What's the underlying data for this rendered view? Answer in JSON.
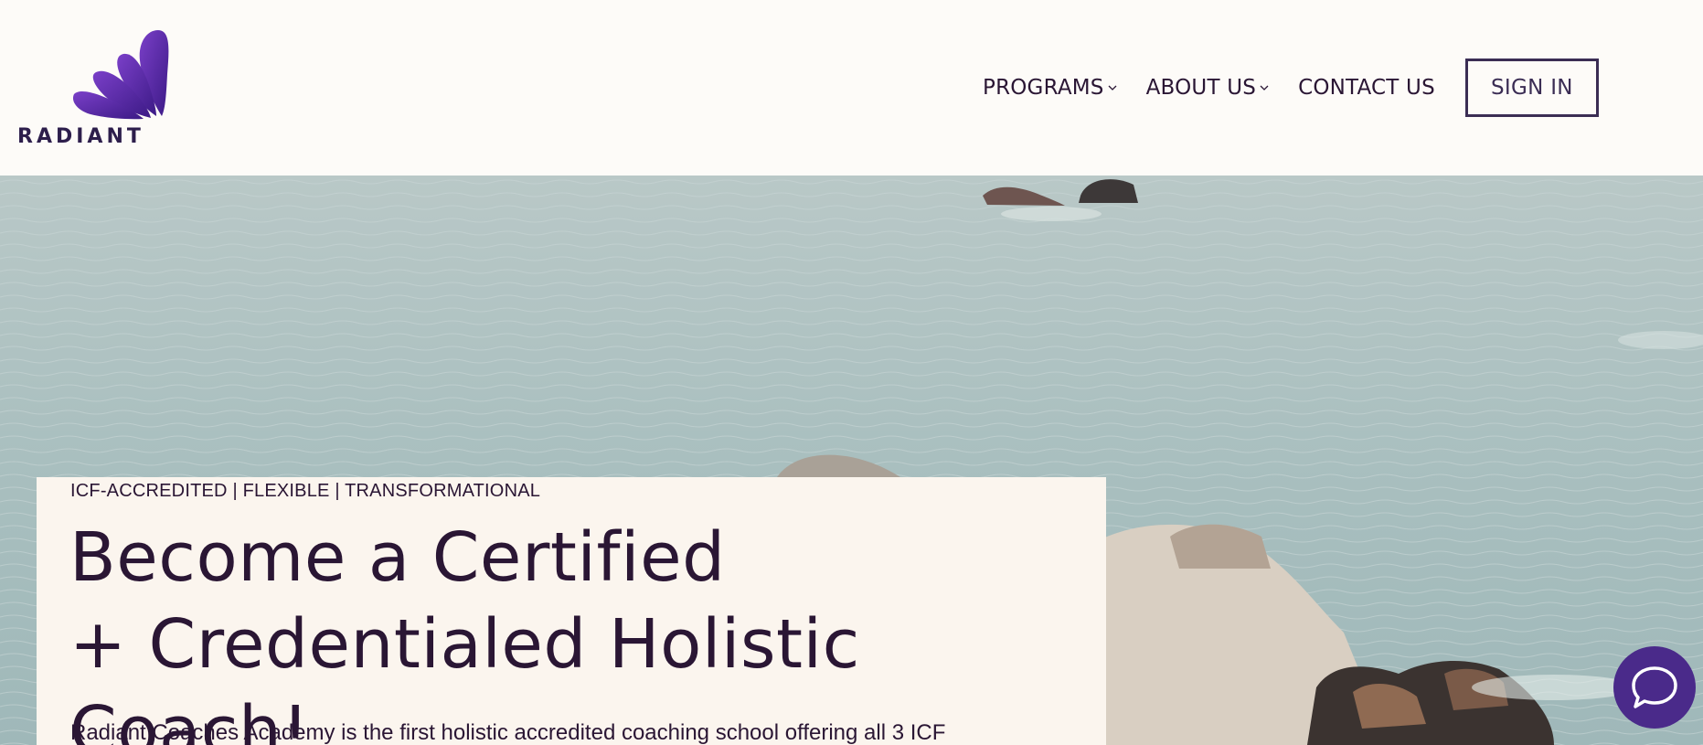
{
  "brand": {
    "name": "RADIANT"
  },
  "nav": {
    "items": [
      {
        "label": "PROGRAMS",
        "has_dropdown": true
      },
      {
        "label": "ABOUT US",
        "has_dropdown": true
      },
      {
        "label": "CONTACT US",
        "has_dropdown": false
      }
    ],
    "sign_in": "SIGN IN"
  },
  "hero": {
    "tagline": "ICF-ACCREDITED | FLEXIBLE | TRANSFORMATIONAL",
    "headline_line1": "Become a Certified",
    "headline_line2": "+ Credentialed Holistic Coach!",
    "body": "Radiant Coaches Academy is the first holistic accredited coaching school offering all 3 ICF"
  },
  "icons": {
    "logo": "radiant-petals-logo-icon",
    "dropdown": "chevron-down-icon",
    "chat": "chat-bubble-icon"
  },
  "colors": {
    "brand_purple": "#4a2a8a",
    "text_dark": "#2a1634",
    "header_bg": "#fdfbf8",
    "card_bg": "#fbf5ee"
  }
}
